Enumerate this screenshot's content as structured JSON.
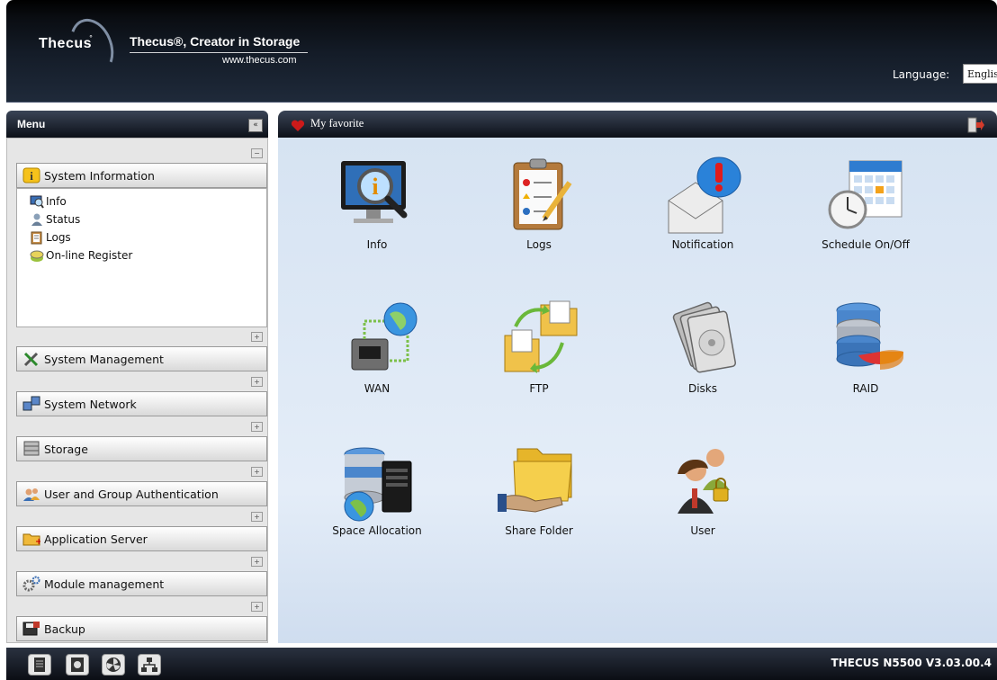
{
  "header": {
    "logo_text": "Thecus",
    "slogan": "Thecus®, Creator in Storage",
    "website": "www.thecus.com",
    "language_label": "Language:",
    "language_value": "English"
  },
  "menu": {
    "title": "Menu",
    "collapse_glyph": "«",
    "sections": [
      {
        "label": "System Information",
        "icon": "info-icon",
        "expanded": true,
        "items": [
          {
            "label": "Info",
            "icon": "monitor-magnifier-icon"
          },
          {
            "label": "Status",
            "icon": "status-person-icon"
          },
          {
            "label": "Logs",
            "icon": "clipboard-icon"
          },
          {
            "label": "On-line Register",
            "icon": "register-icon"
          }
        ]
      },
      {
        "label": "System Management",
        "icon": "tools-icon"
      },
      {
        "label": "System Network",
        "icon": "network-icon"
      },
      {
        "label": "Storage",
        "icon": "storage-icon"
      },
      {
        "label": "User and Group Authentication",
        "icon": "users-icon"
      },
      {
        "label": "Application Server",
        "icon": "folder-plus-icon"
      },
      {
        "label": "Module management",
        "icon": "gears-icon"
      },
      {
        "label": "Backup",
        "icon": "backup-icon"
      }
    ]
  },
  "favorites": {
    "title": "My favorite",
    "tiles": [
      {
        "label": "Info",
        "icon": "info-monitor-icon"
      },
      {
        "label": "Logs",
        "icon": "logs-clipboard-icon"
      },
      {
        "label": "Notification",
        "icon": "notification-icon"
      },
      {
        "label": "Schedule On/Off",
        "icon": "schedule-icon"
      },
      {
        "label": "WAN",
        "icon": "wan-icon"
      },
      {
        "label": "FTP",
        "icon": "ftp-icon"
      },
      {
        "label": "Disks",
        "icon": "disks-icon"
      },
      {
        "label": "RAID",
        "icon": "raid-icon"
      },
      {
        "label": "Space Allocation",
        "icon": "space-allocation-icon"
      },
      {
        "label": "Share Folder",
        "icon": "share-folder-icon"
      },
      {
        "label": "User",
        "icon": "user-icon"
      }
    ]
  },
  "footer": {
    "version": "THECUS N5500 V3.03.00.4",
    "buttons": [
      "nas-status-icon",
      "disk-status-icon",
      "fan-status-icon",
      "network-status-icon"
    ]
  },
  "colors": {
    "header_dark": "#0b0f17",
    "content_bg": "#dce7f4",
    "menu_bg": "#e6e6e6",
    "heart_red": "#cc1a1a"
  }
}
